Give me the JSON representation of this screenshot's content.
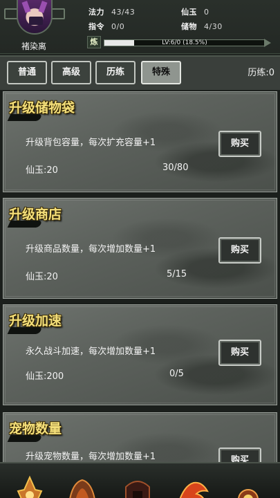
{
  "player": {
    "name": "褚染离",
    "stats": {
      "mana_label": "法力",
      "mana_value": "43/43",
      "order_label": "指令",
      "order_value": "0/0",
      "jade_label": "仙玉",
      "jade_value": "0",
      "storage_label": "储物",
      "storage_value": "4/30"
    },
    "xp": {
      "badge": "炼",
      "text": "LV:6/0 (18.5%)",
      "fraction": 0.185
    }
  },
  "tabs": [
    {
      "label": "普通",
      "active": false
    },
    {
      "label": "高级",
      "active": false
    },
    {
      "label": "历练",
      "active": false
    },
    {
      "label": "特殊",
      "active": true
    }
  ],
  "experience_label": "历练:0",
  "cards": [
    {
      "title": "升级储物袋",
      "desc": "升级背包容量，每次扩充容量+1",
      "cost": "仙玉:20",
      "progress": "30/80",
      "button": "购买"
    },
    {
      "title": "升级商店",
      "desc": "升级商品数量，每次增加数量+1",
      "cost": "仙玉:20",
      "progress": "5/15",
      "button": "购买"
    },
    {
      "title": "升级加速",
      "desc": "永久战斗加速，每次增加数量+1",
      "cost": "仙玉:200",
      "progress": "0/5",
      "button": "购买"
    },
    {
      "title": "宠物数量",
      "desc": "升级宠物数量，每次增加数量+1",
      "cost": "",
      "progress": "",
      "button": "购买"
    }
  ],
  "colors": {
    "title_gold": "#f5e07a",
    "card_bg": "#5d625d",
    "header_bg": "#232824"
  },
  "bottom_nav_icons": [
    "flame-emblem-icon",
    "ornate-crest-icon",
    "gate-arch-icon",
    "phoenix-icon",
    "sun-emblem-icon"
  ]
}
